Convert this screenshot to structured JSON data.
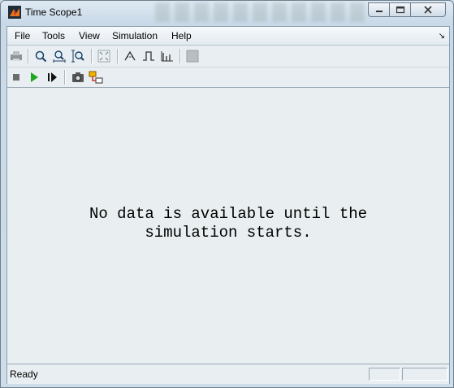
{
  "window": {
    "title": "Time Scope1",
    "icon": "matlab-icon"
  },
  "menu": {
    "items": [
      "File",
      "Tools",
      "View",
      "Simulation",
      "Help"
    ],
    "overflow_icon": "menu-arrow-icon"
  },
  "toolbar1": {
    "icons": [
      "print-icon",
      "zoom-in-icon",
      "zoom-x-icon",
      "zoom-y-icon",
      "autoscale-icon",
      "trigger-icon",
      "pulse-icon",
      "measurements-icon",
      "disabled-icon"
    ]
  },
  "toolbar2": {
    "icons": [
      "stop-icon",
      "run-icon",
      "step-forward-icon",
      "snapshot-icon",
      "highlight-simulink-icon"
    ]
  },
  "canvas": {
    "message_line1": "No data is available until the",
    "message_line2": "simulation starts."
  },
  "status": {
    "text": "Ready"
  },
  "colors": {
    "run_green": "#1fa81f",
    "menu_bg": "#eef2f5",
    "canvas_bg": "#e9eff0"
  }
}
